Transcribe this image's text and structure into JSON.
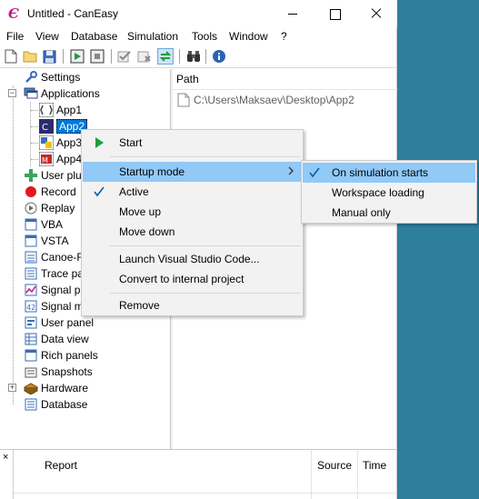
{
  "window": {
    "title": "Untitled - CanEasy",
    "app_icon_glyph": "Є"
  },
  "menubar": {
    "items": [
      "File",
      "View",
      "Database",
      "Simulation",
      "Tools",
      "Window",
      "?"
    ]
  },
  "toolbar": {
    "buttons": [
      "new-file-icon",
      "open-folder-icon",
      "save-icon",
      "start-simulation-icon",
      "stop-simulation-icon",
      "check-icon",
      "clear-check-icon",
      "switch-icon",
      "binoculars-icon",
      "info-icon"
    ]
  },
  "tree": {
    "settings": "Settings",
    "applications": "Applications",
    "app1": "App1",
    "app2": "App2",
    "app3": "App3",
    "app4": "App4",
    "user_plugins": "User plu",
    "record": "Record",
    "replay": "Replay",
    "vba": "VBA",
    "vsta": "VSTA",
    "canoe": "Canoe-F",
    "trace": "Trace pa",
    "signal1": "Signal p",
    "signal2": "Signal m",
    "user_panel": "User panel",
    "data_view": "Data view",
    "rich_panels": "Rich panels",
    "snapshots": "Snapshots",
    "hardware": "Hardware",
    "database": "Database"
  },
  "detail": {
    "path_header": "Path",
    "path_value": "C:\\Users\\Maksaev\\Desktop\\App2"
  },
  "report": {
    "close": "×",
    "col_report": "Report",
    "col_source": "Source",
    "col_time": "Time"
  },
  "context_menu": {
    "start": "Start",
    "startup_mode": "Startup mode",
    "active": "Active",
    "move_up": "Move up",
    "move_down": "Move down",
    "launch_vscode": "Launch Visual Studio Code...",
    "convert": "Convert to internal project",
    "remove": "Remove"
  },
  "submenu": {
    "on_simulation_starts": "On simulation starts",
    "workspace_loading": "Workspace loading",
    "manual_only": "Manual only"
  },
  "colors": {
    "accent": "#0078d7",
    "menu_highlight": "#91c9f7",
    "desktop": "#2e7f9c",
    "start_green": "#1e9e3e",
    "check_blue": "#0b5ea8"
  }
}
